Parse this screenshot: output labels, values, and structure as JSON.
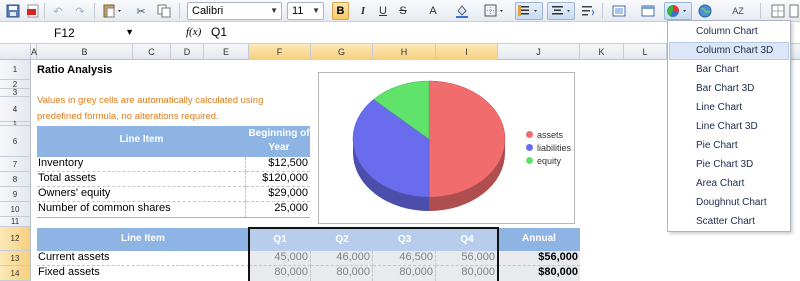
{
  "toolbar": {
    "font_name": "Calibri",
    "font_size": "11",
    "bold_label": "B",
    "italic_label": "I",
    "underline_label": "U",
    "strike_label": "S",
    "font_color_label": "A",
    "sort_label": "AZ",
    "icons": [
      "save-icon",
      "pdf-icon",
      "undo-icon",
      "redo-icon",
      "paste-icon",
      "cut-icon",
      "copy-icon",
      "fill-color-icon",
      "borders-icon",
      "align-icon",
      "wrap-icon",
      "image-icon",
      "table-icon",
      "chart-icon",
      "globe-icon",
      "sort-icon",
      "gridlines-icon"
    ]
  },
  "formula_bar": {
    "cell_ref": "F12",
    "fx_label": "f(x)",
    "value": "Q1"
  },
  "columns": [
    "A",
    "B",
    "C",
    "D",
    "E",
    "F",
    "G",
    "H",
    "I",
    "J",
    "K",
    "L"
  ],
  "selected_columns": [
    "F",
    "G",
    "H",
    "I"
  ],
  "rows": [
    "1",
    "2",
    "3",
    "4",
    "5",
    "6",
    "7",
    "8",
    "9",
    "10",
    "11",
    "12",
    "13",
    "14"
  ],
  "selected_rows": [
    "12",
    "13",
    "14"
  ],
  "sheet": {
    "title": "Ratio Analysis",
    "note": "Values in grey cells are automatically calculated using predefined formula, no alterations required.",
    "table1": {
      "header_item": "Line Item",
      "header_value": "Beginning of Year",
      "rows": [
        {
          "label": "Inventory",
          "value": "$12,500"
        },
        {
          "label": "Total assets",
          "value": "$120,000"
        },
        {
          "label": "Owners' equity",
          "value": "$29,000"
        },
        {
          "label": "Number of common shares",
          "value": "25,000"
        }
      ]
    },
    "table2": {
      "header_item": "Line Item",
      "quarters": [
        "Q1",
        "Q2",
        "Q3",
        "Q4"
      ],
      "header_annual": "Annual",
      "rows": [
        {
          "label": "Current assets",
          "q": [
            "45,000",
            "46,000",
            "46,500",
            "56,000"
          ],
          "annual": "$56,000"
        },
        {
          "label": "Fixed assets",
          "q": [
            "80,000",
            "80,000",
            "80,000",
            "80,000"
          ],
          "annual": "$80,000"
        }
      ]
    }
  },
  "chart_data": {
    "type": "pie",
    "title": "",
    "labels": [
      "assets",
      "liabilities",
      "equity"
    ],
    "values": [
      50,
      37,
      13
    ],
    "colors": [
      "#f16d6d",
      "#6a6cee",
      "#5fe36a"
    ],
    "legend_position": "right",
    "style": "3d"
  },
  "chart_menu": {
    "items": [
      "Column Chart",
      "Column Chart 3D",
      "Bar Chart",
      "Bar Chart 3D",
      "Line Chart",
      "Line Chart 3D",
      "Pie Chart",
      "Pie Chart 3D",
      "Area Chart",
      "Doughnut Chart",
      "Scatter Chart"
    ],
    "highlighted": "Column Chart 3D"
  }
}
